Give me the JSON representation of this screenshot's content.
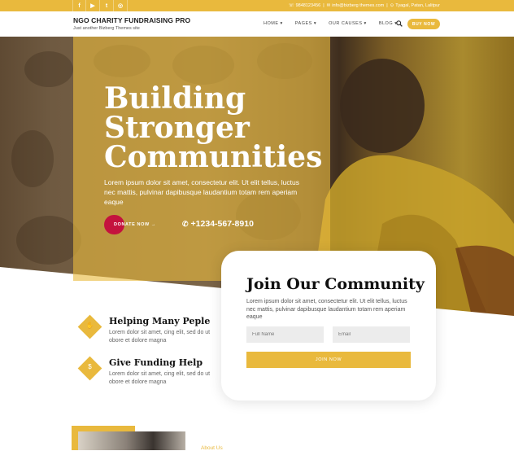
{
  "colors": {
    "accent": "#e9b93d",
    "donate": "#c4123e"
  },
  "topbar": {
    "social": [
      "f",
      "▶",
      "t",
      "◎"
    ],
    "social_icons": [
      "facebook-icon",
      "youtube-icon",
      "twitter-icon",
      "instagram-icon"
    ],
    "phone": "9848123456",
    "email": "info@bizberg themes.com",
    "address": "Tyagal, Patan, Lalitpur"
  },
  "header": {
    "site_title": "NGO CHARITY FUNDRAISING PRO",
    "tagline": "Just another Bizberg Themes site",
    "nav": [
      "HOME ▾",
      "PAGES ▾",
      "OUR CAUSES ▾",
      "BLOG ▾"
    ],
    "buy_label": "BUY NOW"
  },
  "hero": {
    "headline": "Building Stronger Communities",
    "text": "Lorem ipsum dolor sit amet, consectetur elit. Ut elit tellus, luctus nec mattis, pulvinar dapibusque laudantium totam rem aperiam eaque",
    "donate_label": "DONATE NOW →",
    "phone": "+1234-567-8910"
  },
  "join": {
    "title": "Join Our Community",
    "text": "Lorem ipsum dolor sit amet, consectetur elit. Ut elit tellus, luctus nec mattis, pulvinar dapibusque laudantium totam rem aperiam eaque",
    "name_placeholder": "Full Name",
    "email_placeholder": "Email",
    "button_label": "JOIN NOW"
  },
  "features": [
    {
      "title": "Helping Many Peple",
      "text": "Lorem dolor sit amet, cing elit, sed do ut obore et dolore magna",
      "icon": "helping-hand-icon"
    },
    {
      "title": "Give Funding Help",
      "text": "Lorem dolor sit amet, cing elit, sed do ut obore et dolore magna",
      "icon": "funding-icon"
    }
  ],
  "about": {
    "label": "About Us"
  }
}
